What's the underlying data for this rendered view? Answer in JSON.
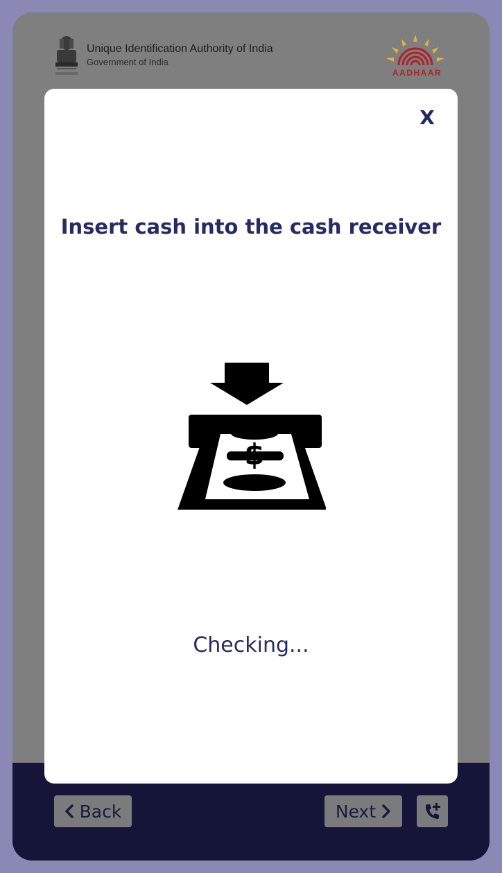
{
  "header": {
    "org_title": "Unique Identification Authority of India",
    "org_subtitle": "Government of India",
    "emblem_icon": "national-emblem-icon",
    "logo_icon": "aadhaar-logo-icon",
    "logo_text": "AADHAAR"
  },
  "modal": {
    "close_label": "X",
    "title": "Insert cash into the cash receiver",
    "illustration_icon": "cash-insert-icon",
    "status": "Checking..."
  },
  "footer": {
    "back_label": "Back",
    "next_label": "Next",
    "call_icon": "phone-plus-icon"
  },
  "colors": {
    "frame": "#8a89b6",
    "overlay": "#7f7f7f",
    "footer": "#141538",
    "modal_text": "#272a63",
    "logo_red": "#b32026",
    "logo_yellow": "#e2b43a"
  }
}
